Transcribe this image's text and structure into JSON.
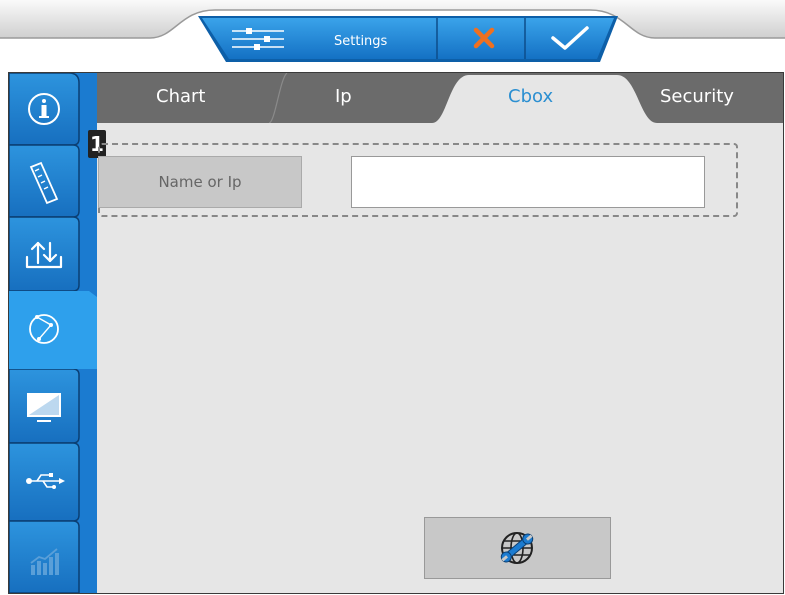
{
  "header": {
    "settings_icon": "sliders-icon",
    "title": "Settings",
    "cancel_icon": "close-icon",
    "confirm_icon": "check-icon"
  },
  "tabs": [
    {
      "label": "Chart"
    },
    {
      "label": "Ip"
    },
    {
      "label": "Cbox",
      "active": true
    },
    {
      "label": "Security"
    }
  ],
  "sidebar": {
    "items": [
      {
        "icon": "info-icon"
      },
      {
        "icon": "ruler-icon"
      },
      {
        "icon": "upload-download-icon"
      },
      {
        "icon": "network-icon",
        "active": true
      },
      {
        "icon": "monitor-icon"
      },
      {
        "icon": "usb-icon"
      },
      {
        "icon": "chart-icon",
        "disabled": true
      }
    ]
  },
  "content": {
    "group_badge": "1",
    "name_button_label": "Name or Ip",
    "name_input_value": "",
    "tool_button_icon": "globe-wrench-icon"
  },
  "colors": {
    "accent": "#1e88d6",
    "accent_dark": "#0d5fa8",
    "cancel": "#f07020",
    "panel_bg": "#e6e6e6",
    "tab_bg": "#6b6b6b"
  }
}
